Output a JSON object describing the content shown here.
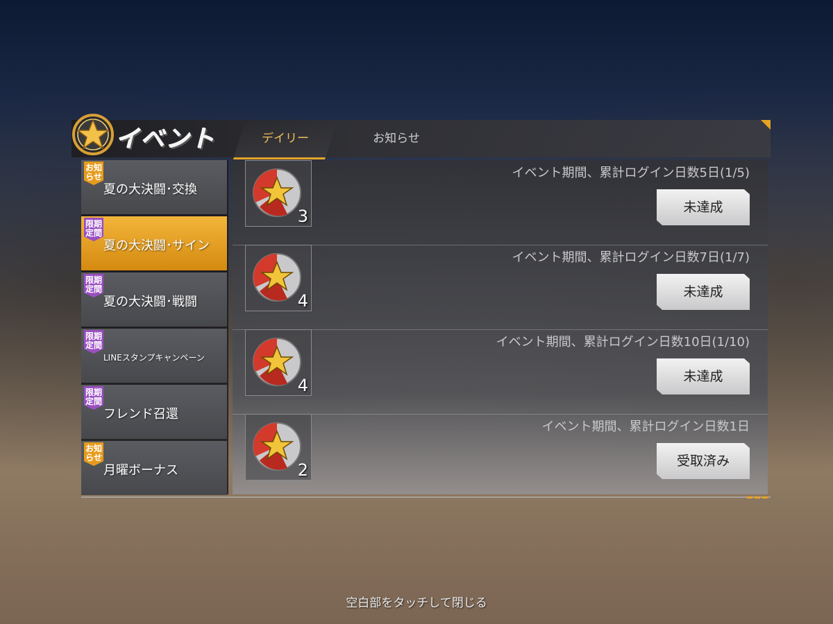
{
  "header": {
    "title": "イベント",
    "tabs": [
      {
        "label": "デイリー",
        "active": true
      },
      {
        "label": "お知らせ",
        "active": false
      }
    ]
  },
  "sidebar": {
    "items": [
      {
        "label": "夏の大決闘･交換",
        "badge": "お知らせ",
        "badge_color": "#e69b1c",
        "active": false
      },
      {
        "label": "夏の大決闘･サイン",
        "badge": "限期定間",
        "badge_color": "#9a4fc2",
        "active": true
      },
      {
        "label": "夏の大決闘･戦闘",
        "badge": "限期定間",
        "badge_color": "#9a4fc2",
        "active": false
      },
      {
        "label": "LINEスタンプキャンペーン",
        "badge": "限期定間",
        "badge_color": "#9a4fc2",
        "active": false
      },
      {
        "label": "フレンド召還",
        "badge": "限期定間",
        "badge_color": "#9a4fc2",
        "active": false
      },
      {
        "label": "月曜ボーナス",
        "badge": "お知らせ",
        "badge_color": "#e69b1c",
        "active": false
      }
    ]
  },
  "rewards": [
    {
      "description": "イベント期間、累計ログイン日数5日(1/5)",
      "count": "3",
      "status": "未達成",
      "icon": "star-medal-icon"
    },
    {
      "description": "イベント期間、累計ログイン日数7日(1/7)",
      "count": "4",
      "status": "未達成",
      "icon": "star-medal-icon"
    },
    {
      "description": "イベント期間、累計ログイン日数10日(1/10)",
      "count": "4",
      "status": "未達成",
      "icon": "star-medal-icon"
    },
    {
      "description": "イベント期間、累計ログイン日数1日",
      "count": "2",
      "status": "受取済み",
      "icon": "star-medal-icon"
    }
  ],
  "footer": {
    "close_hint": "空白部をタッチして閉じる"
  },
  "colors": {
    "accent": "#e6a424",
    "active_item": "#f2b53a",
    "badge_purple": "#9a4fc2",
    "badge_orange": "#e69b1c"
  }
}
